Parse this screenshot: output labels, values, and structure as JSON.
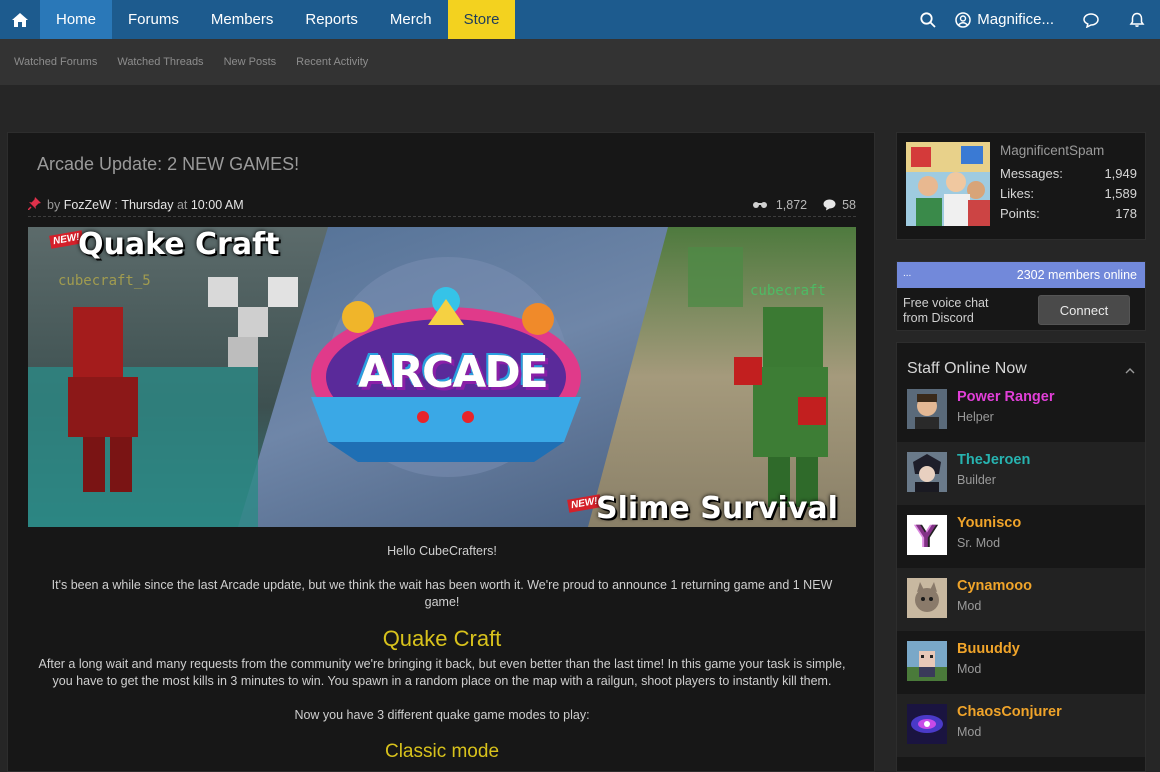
{
  "nav": {
    "items": [
      {
        "label": "Home"
      },
      {
        "label": "Forums"
      },
      {
        "label": "Members"
      },
      {
        "label": "Reports"
      },
      {
        "label": "Merch"
      },
      {
        "label": "Store"
      }
    ],
    "user_label": "Magnifice..."
  },
  "subnav": [
    "Watched Forums",
    "Watched Threads",
    "New Posts",
    "Recent Activity"
  ],
  "thread": {
    "title": "Arcade Update: 2 NEW GAMES!",
    "by": "by",
    "author": "FozZeW",
    "sep": " : ",
    "day": "Thursday",
    "at": "at",
    "time": "10:00 AM",
    "views": "1,872",
    "replies": "58"
  },
  "banner": {
    "left_title": "Quake Craft",
    "right_title": "Slime Survival",
    "badge": "NEW!",
    "center_word": "ARCADE",
    "left_tag": "cubecraft_5",
    "right_tag": "cubecraft"
  },
  "post": {
    "greeting": "Hello CubeCrafters!",
    "intro": "It's been a while since the last Arcade update, but we think the wait has been worth it. We're proud to announce 1 returning game and 1 NEW game!",
    "section1_title": "Quake Craft",
    "section1_text": "After a long wait and many requests from the community we're bringing it back, but even better than the last time! In this game your task is simple, you have to get the most kills in 3 minutes to win. You spawn in a random place on the map with a railgun, shoot players to instantly kill them.",
    "modes_text": "Now you have 3 different quake game modes to play:",
    "mode1_title": "Classic mode"
  },
  "profile": {
    "name": "MagnificentSpam",
    "messages_label": "Messages:",
    "messages": "1,949",
    "likes_label": "Likes:",
    "likes": "1,589",
    "points_label": "Points:",
    "points": "178"
  },
  "discord": {
    "dots": "...",
    "online": "2302 members online",
    "text_line1": "Free voice chat",
    "text_line2": "from Discord",
    "button": "Connect"
  },
  "staff": {
    "heading": "Staff Online Now",
    "members": [
      {
        "name": "Power Ranger",
        "role": "Helper",
        "color": "#e13fd8"
      },
      {
        "name": "TheJeroen",
        "role": "Builder",
        "color": "#27b3b0"
      },
      {
        "name": "Younisco",
        "role": "Sr. Mod",
        "color": "#f0a42a"
      },
      {
        "name": "Cynamooo",
        "role": "Mod",
        "color": "#f0a42a"
      },
      {
        "name": "Buuuddy",
        "role": "Mod",
        "color": "#f0a42a"
      },
      {
        "name": "ChaosConjurer",
        "role": "Mod",
        "color": "#f0a42a"
      }
    ]
  }
}
